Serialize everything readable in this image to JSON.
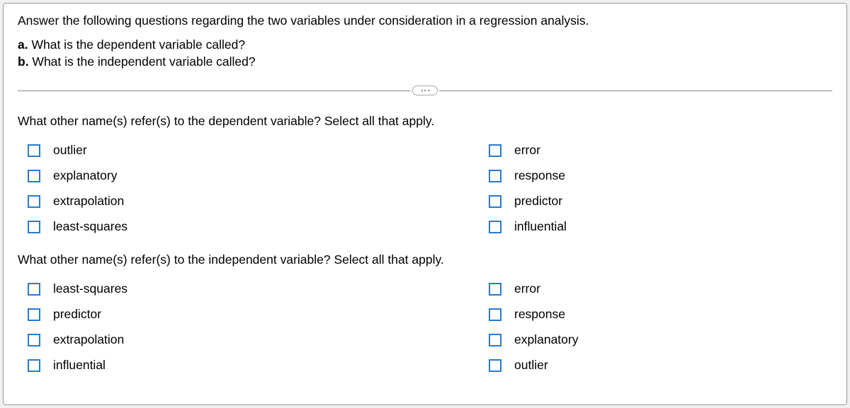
{
  "intro": "Answer the following questions regarding the two variables under consideration in a regression analysis.",
  "subA_label": "a.",
  "subA_text": " What is the dependent variable called?",
  "subB_label": "b.",
  "subB_text": " What is the independent variable called?",
  "section1_prompt": "What other name(s) refer(s) to the dependent variable? Select all that apply.",
  "section1_left": [
    "outlier",
    "explanatory",
    "extrapolation",
    "least-squares"
  ],
  "section1_right": [
    "error",
    "response",
    "predictor",
    "influential"
  ],
  "section2_prompt": "What other name(s) refer(s) to the independent variable? Select all that apply.",
  "section2_left": [
    "least-squares",
    "predictor",
    "extrapolation",
    "influential"
  ],
  "section2_right": [
    "error",
    "response",
    "explanatory",
    "outlier"
  ]
}
